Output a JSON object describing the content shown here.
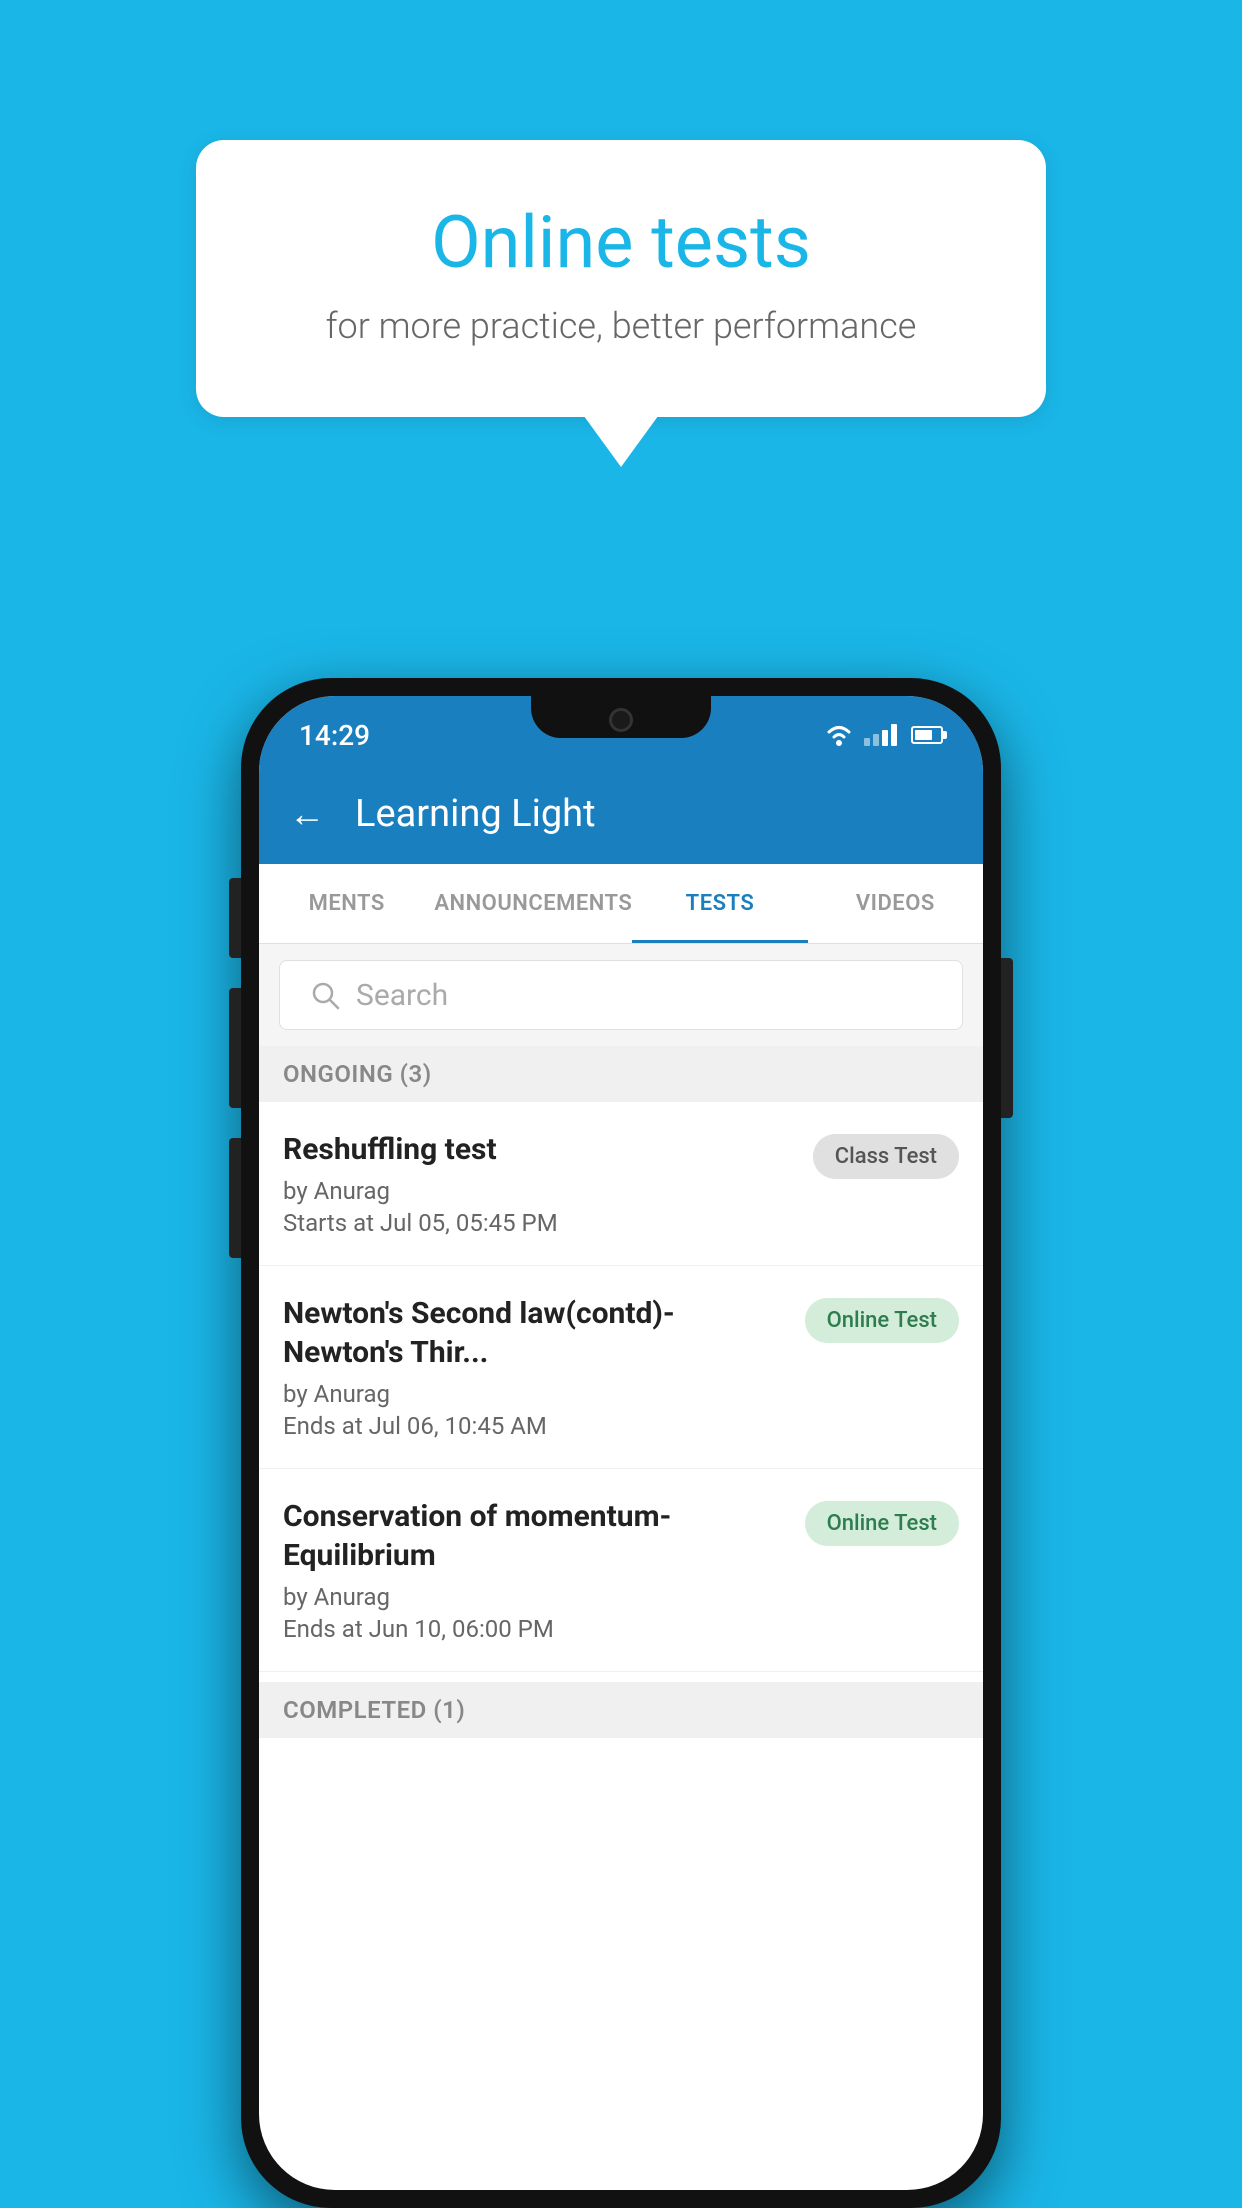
{
  "background_color": "#1ab6e8",
  "speech_bubble": {
    "title": "Online tests",
    "subtitle": "for more practice, better performance"
  },
  "phone": {
    "status_bar": {
      "time": "14:29"
    },
    "header": {
      "title": "Learning Light",
      "back_label": "←"
    },
    "tabs": [
      {
        "label": "MENTS",
        "active": false
      },
      {
        "label": "ANNOUNCEMENTS",
        "active": false
      },
      {
        "label": "TESTS",
        "active": true
      },
      {
        "label": "VIDEOS",
        "active": false
      }
    ],
    "search": {
      "placeholder": "Search"
    },
    "sections": [
      {
        "title": "ONGOING (3)",
        "tests": [
          {
            "name": "Reshuffling test",
            "author": "by Anurag",
            "date": "Starts at  Jul 05, 05:45 PM",
            "badge": "Class Test",
            "badge_type": "class"
          },
          {
            "name": "Newton's Second law(contd)-Newton's Thir...",
            "author": "by Anurag",
            "date": "Ends at  Jul 06, 10:45 AM",
            "badge": "Online Test",
            "badge_type": "online"
          },
          {
            "name": "Conservation of momentum-Equilibrium",
            "author": "by Anurag",
            "date": "Ends at  Jun 10, 06:00 PM",
            "badge": "Online Test",
            "badge_type": "online"
          }
        ]
      }
    ],
    "completed_section_label": "COMPLETED (1)"
  }
}
